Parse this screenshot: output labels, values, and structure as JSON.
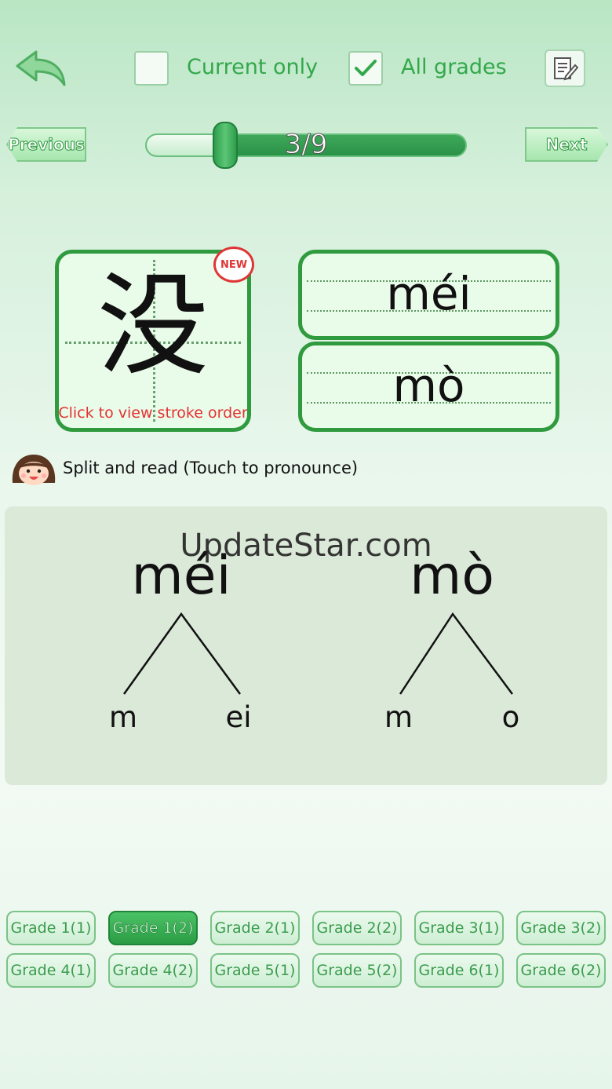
{
  "toolbar": {
    "current_only_label": "Current only",
    "current_only_checked": false,
    "all_grades_label": "All grades",
    "all_grades_checked": true
  },
  "nav": {
    "previous_label": "Previous",
    "next_label": "Next",
    "progress_text": "3/9",
    "current": 3,
    "total": 9
  },
  "character": {
    "hanzi": "没",
    "badge": "NEW",
    "stroke_hint": "Click to view stroke order"
  },
  "pinyin": [
    "méi",
    "mò"
  ],
  "split": {
    "title": "Split and read (Touch to pronounce)",
    "watermark": "UpdateStar.com",
    "syllables": [
      {
        "full": "méi",
        "initial": "m",
        "final": "ei"
      },
      {
        "full": "mò",
        "initial": "m",
        "final": "o"
      }
    ]
  },
  "grades": [
    "Grade 1(1)",
    "Grade 1(2)",
    "Grade 2(1)",
    "Grade 2(2)",
    "Grade 3(1)",
    "Grade 3(2)",
    "Grade 4(1)",
    "Grade 4(2)",
    "Grade 5(1)",
    "Grade 5(2)",
    "Grade 6(1)",
    "Grade 6(2)"
  ],
  "active_grade": "Grade 1(2)",
  "colors": {
    "accent": "#2f9a3e",
    "text_green": "#33a84b",
    "hint_red": "#e53232"
  }
}
